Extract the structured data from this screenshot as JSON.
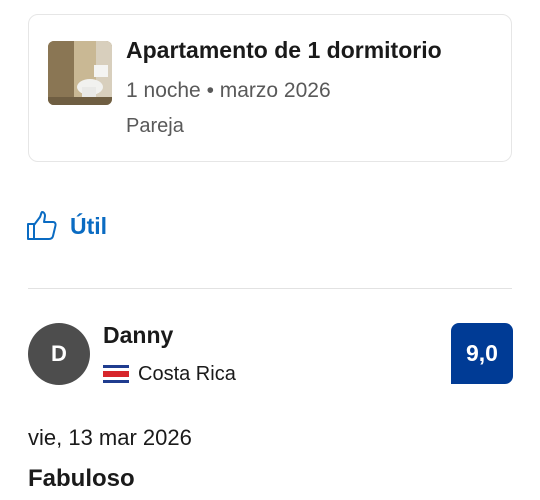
{
  "stay": {
    "room_title": "Apartamento de 1 dormitorio",
    "room_meta": "1 noche • marzo 2026",
    "traveler_type": "Pareja",
    "thumbnail_icon": "room-photo"
  },
  "helpful": {
    "label": "Útil",
    "icon": "thumbs-up-icon",
    "color": "#0a6bc2"
  },
  "reviewer": {
    "initial": "D",
    "name": "Danny",
    "country": "Costa Rica",
    "flag_icon": "costa-rica-flag-icon",
    "score": "9,0",
    "score_color": "#003b95"
  },
  "review": {
    "date": "vie, 13 mar 2026",
    "title": "Fabuloso"
  }
}
